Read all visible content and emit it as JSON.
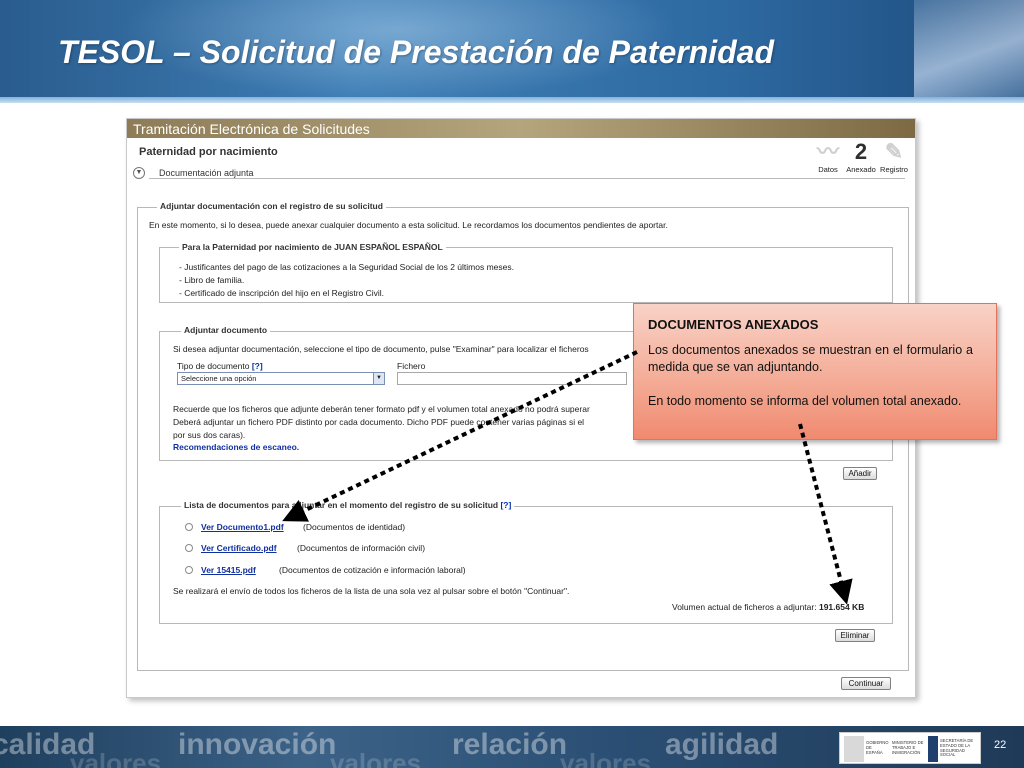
{
  "slide": {
    "title": "TESOL – Solicitud de Prestación de Paternidad",
    "number": "22"
  },
  "app": {
    "window_title": "Tramitación Electrónica de Solicitudes",
    "page_heading": "Paternidad por nacimiento",
    "steps": [
      {
        "label": "Datos",
        "icon": "chart-icon",
        "glyph": "〰"
      },
      {
        "label": "Anexado",
        "icon": "step-2-icon",
        "glyph": "2"
      },
      {
        "label": "Registro",
        "icon": "stamp-icon",
        "glyph": "✎"
      }
    ],
    "section_title": "Documentación adjunta",
    "main_legend": "Adjuntar documentación con el registro de su solicitud",
    "intro_text": "En este momento, si lo desea, puede anexar cualquier documento a esta solicitud. Le recordamos los documentos pendientes de aportar.",
    "pending": {
      "legend": "Para la Paternidad por nacimiento de JUAN ESPAÑOL ESPAÑOL",
      "items": [
        "- Justificantes del pago de las cotizaciones a la Seguridad Social de los 2 últimos meses.",
        "- Libro de familia.",
        "- Certificado de inscripción del hijo en el Registro Civil."
      ]
    },
    "attach": {
      "legend": "Adjuntar documento",
      "instructions": "Si desea adjuntar documentación, seleccione el tipo de documento, pulse \"Examinar\" para localizar el ficheros",
      "doc_type_label": "Tipo de documento",
      "help_marker": "[?]",
      "doc_type_value": "Seleccione una opción",
      "file_label": "Fichero",
      "note_line1": "Recuerde que los ficheros que adjunte deberán tener formato pdf y el volumen total anexado no podrá superar",
      "note_line2": "Deberá adjuntar un fichero PDF distinto por cada documento. Dicho PDF puede contener varias páginas si el",
      "note_line3": "por sus dos caras).",
      "scan_link": "Recomendaciones de escaneo.",
      "add_button": "Añadir"
    },
    "list": {
      "legend": "Lista de documentos para adjuntar en el momento del registro de su solicitud",
      "help_marker": "[?]",
      "documents": [
        {
          "link": "Ver Documento1.pdf",
          "type": "(Documentos de identidad)"
        },
        {
          "link": "Ver Certificado.pdf",
          "type": "(Documentos de información civil)"
        },
        {
          "link": "Ver 15415.pdf",
          "type": "(Documentos de cotización e información laboral)"
        }
      ],
      "send_note": "Se realizará el envío de todos los ficheros de la lista de una sola vez al pulsar sobre el botón \"Continuar\".",
      "volume_label": "Volumen actual de ficheros a adjuntar:",
      "volume_value": "191.654 KB",
      "delete_button": "Eliminar"
    },
    "continue_button": "Continuar"
  },
  "callout": {
    "title": "DOCUMENTOS ANEXADOS",
    "paragraph1": "Los documentos anexados se muestran en el formulario a medida que se van adjuntando.",
    "paragraph2": "En todo momento se informa del volumen total anexado."
  },
  "footer": {
    "words": [
      "calidad",
      "innovación",
      "relación",
      "agilidad"
    ],
    "words_back": [
      "valores",
      "valores",
      "valores"
    ],
    "gov_1": "GOBIERNO DE ESPAÑA",
    "gov_2": "MINISTERIO DE TRABAJO E INMIGRACIÓN",
    "gov_3": "SECRETARÍA DE ESTADO DE LA SEGURIDAD SOCIAL"
  },
  "colors": {
    "header_blue": "#2e6aa2",
    "callout_orange": "#f08a70",
    "link_blue": "#1030a0"
  }
}
